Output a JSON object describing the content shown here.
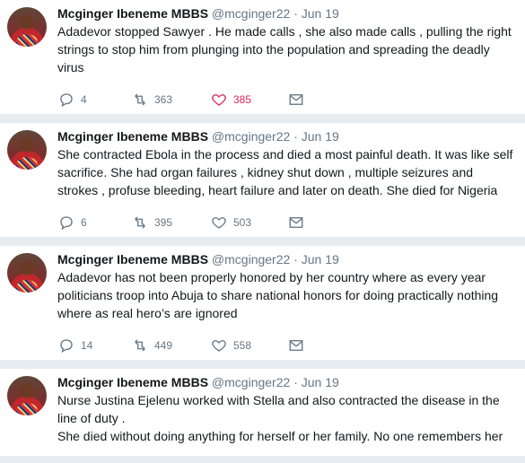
{
  "tweets": [
    {
      "name": "Mcginger Ibeneme MBBS",
      "handle": "@mcginger22",
      "date": "· Jun 19",
      "lines": [
        "Adadevor stopped Sawyer . He made calls , she also made calls , pulling the right",
        "strings to stop him from plunging into the population and spreading the deadly",
        "virus"
      ],
      "replies": "4",
      "retweets": "363",
      "likes": "385",
      "liked": true
    },
    {
      "name": "Mcginger Ibeneme MBBS",
      "handle": "@mcginger22",
      "date": "· Jun 19",
      "lines": [
        "She contracted Ebola in the process and died a most painful death. It was like self",
        "sacrifice. She had organ failures , kidney shut down , multiple seizures and",
        "strokes , profuse bleeding, heart failure and later on death. She died for Nigeria"
      ],
      "replies": "6",
      "retweets": "395",
      "likes": "503",
      "liked": false
    },
    {
      "name": "Mcginger Ibeneme MBBS",
      "handle": "@mcginger22",
      "date": "· Jun 19",
      "lines": [
        "Adadevor has not been properly honored by her country where as every year",
        "politicians troop into Abuja to share national honors for doing practically nothing",
        "where as real hero’s are ignored"
      ],
      "replies": "14",
      "retweets": "449",
      "likes": "558",
      "liked": false
    },
    {
      "name": "Mcginger Ibeneme MBBS",
      "handle": "@mcginger22",
      "date": "· Jun 19",
      "lines": [
        "Nurse Justina Ejelenu worked with Stella and also contracted the disease in the",
        "line of duty .",
        "She died without doing anything for herself or her family. No one remembers her"
      ],
      "replies": "",
      "retweets": "",
      "likes": "",
      "liked": false
    }
  ],
  "icons": {
    "reply": "reply-icon",
    "retweet": "retweet-icon",
    "like": "heart-icon",
    "message": "envelope-icon"
  },
  "colors": {
    "liked": "#e0245e",
    "muted": "#657786",
    "text": "#14171a"
  }
}
